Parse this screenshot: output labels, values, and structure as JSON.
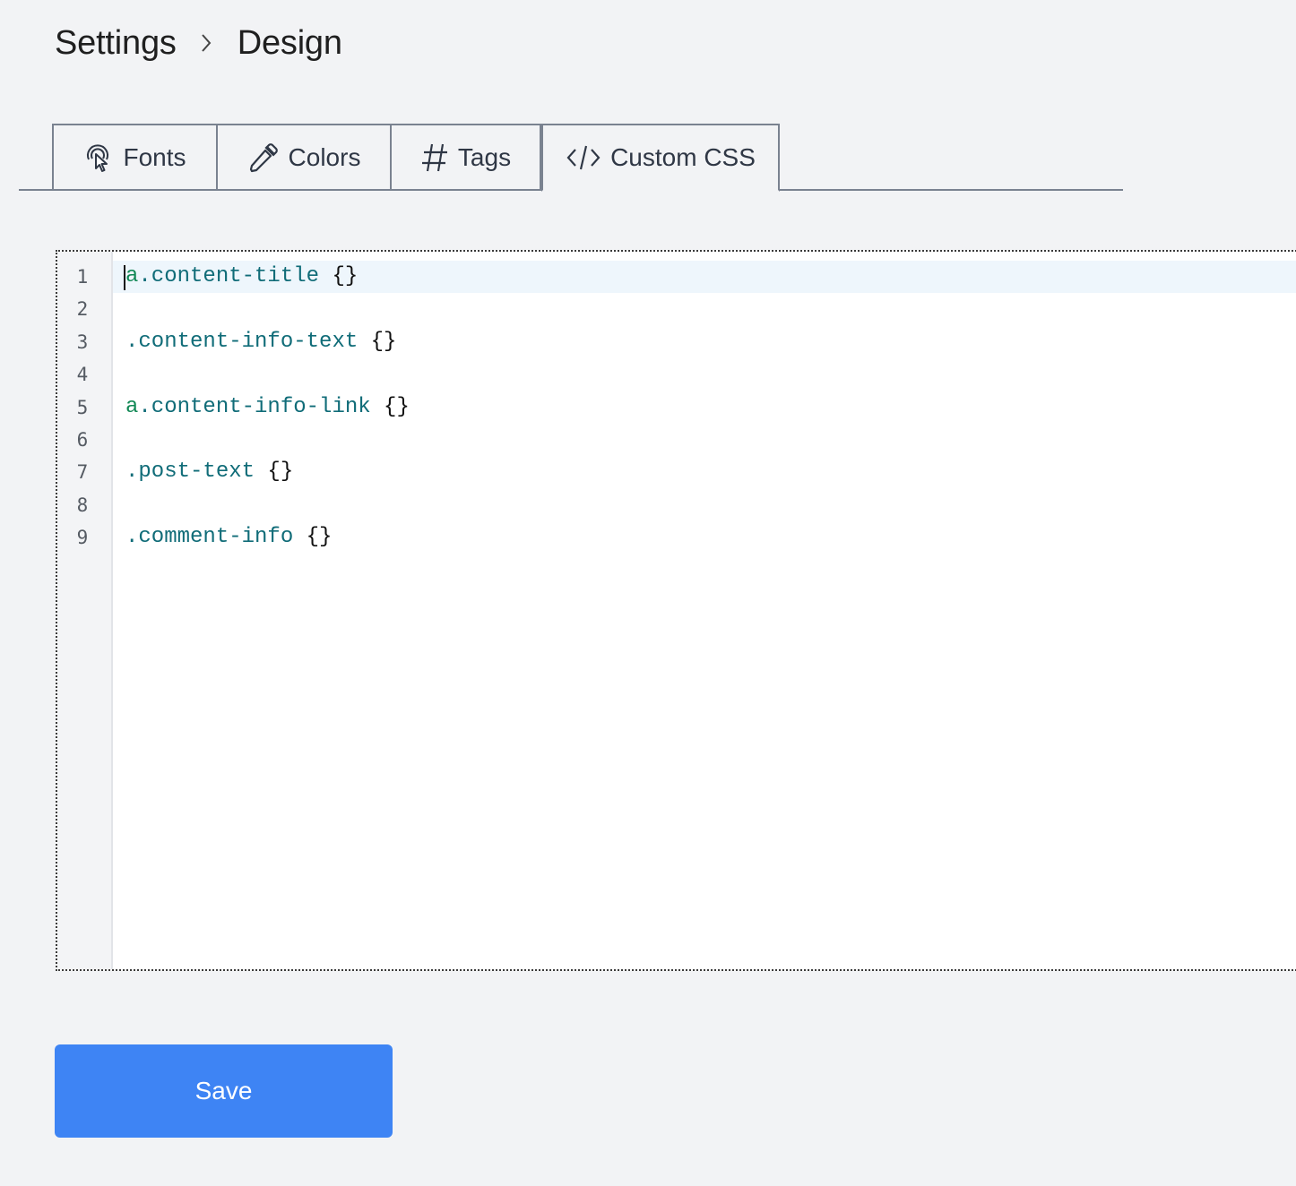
{
  "breadcrumb": {
    "parent": "Settings",
    "current": "Design"
  },
  "tabs": [
    {
      "label": "Fonts",
      "icon": "fonts-icon"
    },
    {
      "label": "Colors",
      "icon": "eyedropper-icon"
    },
    {
      "label": "Tags",
      "icon": "hash-icon"
    },
    {
      "label": "Custom CSS",
      "icon": "code-icon",
      "active": true
    }
  ],
  "editor": {
    "line_numbers": [
      "1",
      "2",
      "3",
      "4",
      "5",
      "6",
      "7",
      "8",
      "9"
    ],
    "lines": [
      {
        "tag": "a",
        "selector": ".content-title",
        "rest": " {}"
      },
      {
        "tag": "",
        "selector": "",
        "rest": ""
      },
      {
        "tag": "",
        "selector": ".content-info-text",
        "rest": " {}"
      },
      {
        "tag": "",
        "selector": "",
        "rest": ""
      },
      {
        "tag": "a",
        "selector": ".content-info-link",
        "rest": " {}"
      },
      {
        "tag": "",
        "selector": "",
        "rest": ""
      },
      {
        "tag": "",
        "selector": ".post-text",
        "rest": " {}"
      },
      {
        "tag": "",
        "selector": "",
        "rest": ""
      },
      {
        "tag": "",
        "selector": ".comment-info",
        "rest": " {}"
      }
    ],
    "active_line": 1
  },
  "actions": {
    "save_label": "Save"
  },
  "colors": {
    "background": "#f2f3f5",
    "accent": "#3e84f4",
    "tab_border": "#7a8290",
    "css_tag": "#118855",
    "css_class": "#106c78"
  }
}
